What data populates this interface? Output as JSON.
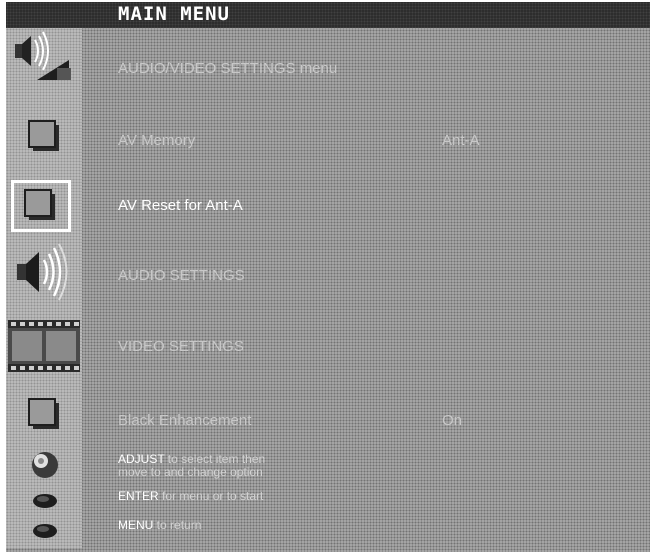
{
  "title": "MAIN MENU",
  "header": "AUDIO/VIDEO SETTINGS menu",
  "items": [
    {
      "label": "AV Memory",
      "value": "Ant-A",
      "selected": false
    },
    {
      "label": "AV Reset for Ant-A",
      "value": "",
      "selected": true
    },
    {
      "label": "AUDIO SETTINGS",
      "value": "",
      "selected": false
    },
    {
      "label": "VIDEO SETTINGS",
      "value": "",
      "selected": false
    },
    {
      "label": "Black Enhancement",
      "value": "On",
      "selected": false
    }
  ],
  "help": {
    "adjust_key": "ADJUST",
    "adjust_line1": " to select item then",
    "adjust_line2": "move to and change option",
    "enter_key": "ENTER",
    "enter_text": " for menu or to start",
    "menu_key": "MENU",
    "menu_text": " to return"
  },
  "sidebar_icons": [
    "av-settings-icon",
    "av-memory-icon",
    "av-reset-icon",
    "audio-speaker-icon",
    "video-film-icon",
    "black-enhancement-icon",
    "adjust-joystick-icon",
    "enter-button-icon",
    "menu-button-icon"
  ],
  "colors": {
    "background": "#a9a9a9",
    "titlebar": "#2b2b2b",
    "selected_text": "#ffffff",
    "item_text": "#c8c8c8"
  }
}
